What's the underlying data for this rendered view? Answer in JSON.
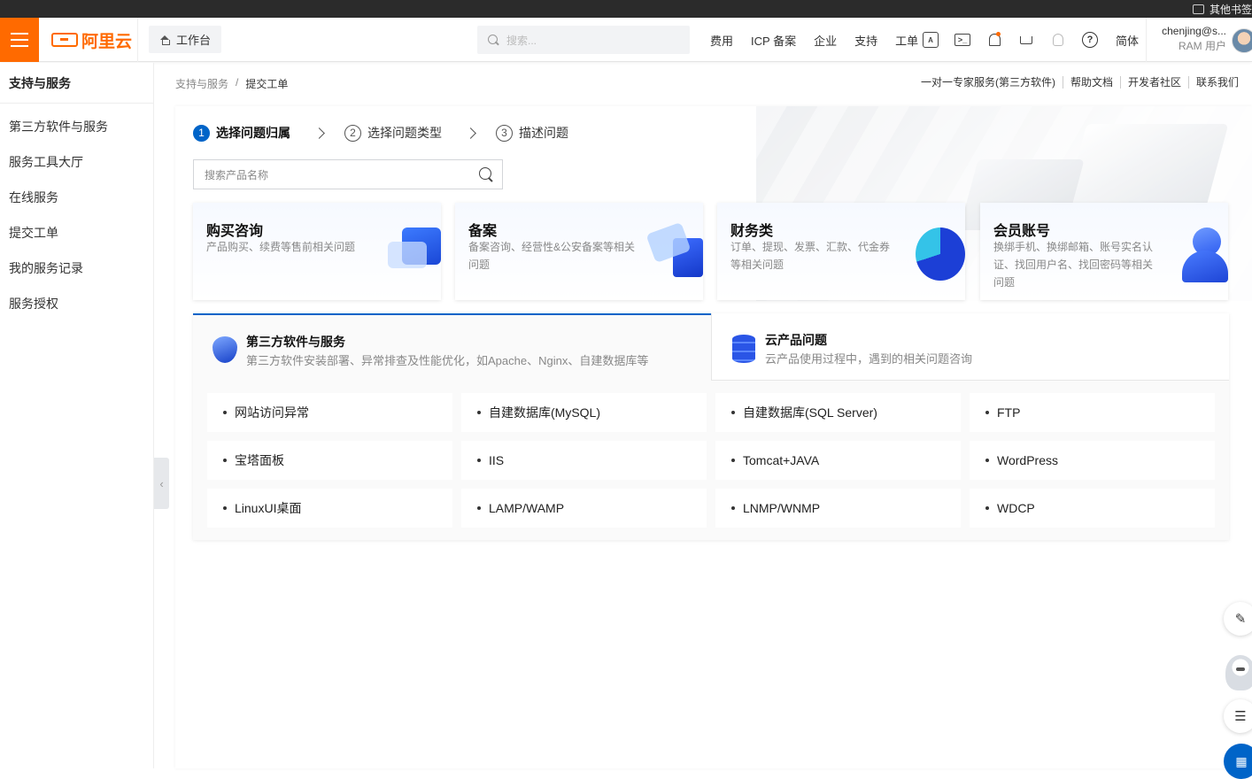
{
  "os_bar": {
    "ext_label": "其他书签"
  },
  "topnav": {
    "logo": "阿里云",
    "workbench": "工作台",
    "search_placeholder": "搜索...",
    "links": [
      "费用",
      "ICP 备案",
      "企业",
      "支持",
      "工单"
    ],
    "icons": [
      "app-icon",
      "terminal-icon",
      "bell-icon",
      "cart-icon",
      "bulb-icon",
      "help-icon"
    ],
    "lang": "简体",
    "user_name": "chenjing@s...",
    "user_role": "RAM 用户"
  },
  "sidebar": {
    "title": "支持与服务",
    "items": [
      "第三方软件与服务",
      "服务工具大厅",
      "在线服务",
      "提交工单",
      "我的服务记录",
      "服务授权"
    ]
  },
  "breadcrumb": {
    "parent": "支持与服务",
    "sep": "/",
    "current": "提交工单"
  },
  "right_links": [
    "一对一专家服务(第三方软件)",
    "帮助文档",
    "开发者社区",
    "联系我们"
  ],
  "steps": [
    {
      "num": "1",
      "label": "选择问题归属"
    },
    {
      "num": "2",
      "label": "选择问题类型"
    },
    {
      "num": "3",
      "label": "描述问题"
    }
  ],
  "product_search": {
    "placeholder": "搜索产品名称"
  },
  "cards": [
    {
      "title": "购买咨询",
      "desc": "产品购买、续费等售前相关问题"
    },
    {
      "title": "备案",
      "desc": "备案咨询、经营性&公安备案等相关问题"
    },
    {
      "title": "财务类",
      "desc": "订单、提现、发票、汇款、代金券等相关问题"
    },
    {
      "title": "会员账号",
      "desc": "换绑手机、换绑邮箱、账号实名认证、找回用户名、找回密码等相关问题"
    }
  ],
  "tabs": [
    {
      "title": "第三方软件与服务",
      "desc": "第三方软件安装部署、异常排查及性能优化，如Apache、Nginx、自建数据库等"
    },
    {
      "title": "云产品问题",
      "desc": "云产品使用过程中，遇到的相关问题咨询"
    }
  ],
  "issues": [
    "网站访问异常",
    "自建数据库(MySQL)",
    "自建数据库(SQL Server)",
    "FTP",
    "宝塔面板",
    "IIS",
    "Tomcat+JAVA",
    "WordPress",
    "LinuxUI桌面",
    "LAMP/WAMP",
    "LNMP/WNMP",
    "WDCP"
  ],
  "colors": {
    "brand": "#ff6a00",
    "primary": "#0064c8"
  }
}
